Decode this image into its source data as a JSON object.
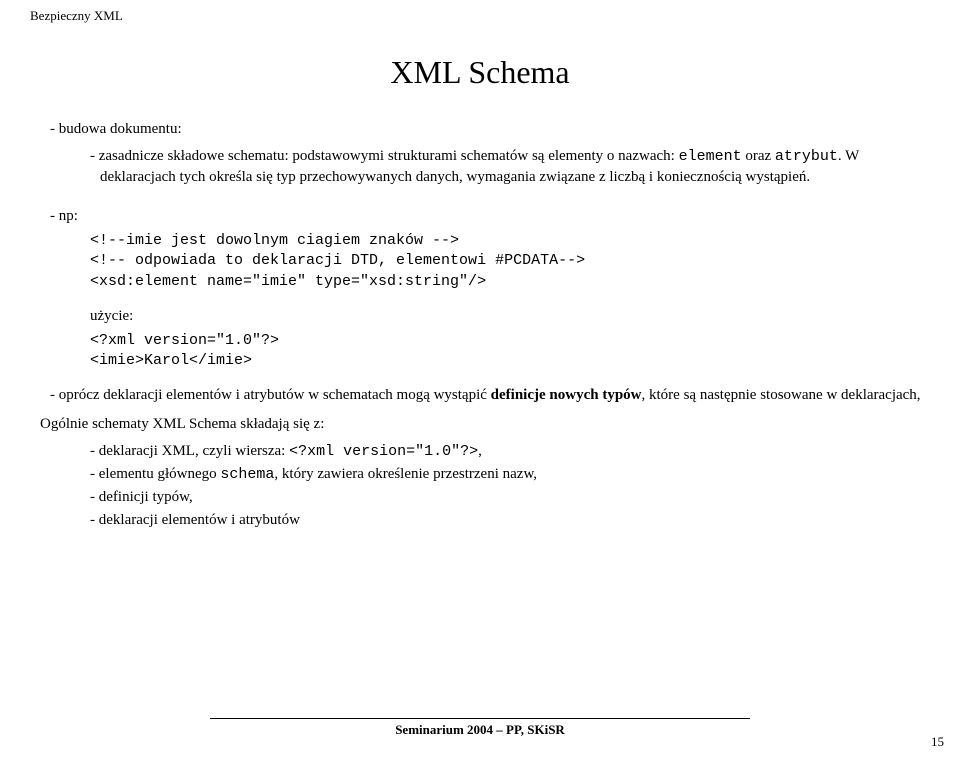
{
  "header": "Bezpieczny XML",
  "title": "XML Schema",
  "section1": "- budowa dokumentu:",
  "bullet1a": "- zasadnicze składowe schematu: podstawowymi strukturami schematów są elementy o nazwach: ",
  "bullet1b_code1": "element",
  "bullet1b_mid": " oraz ",
  "bullet1b_code2": "atrybut",
  "bullet1c": ". W deklaracjach tych określa się typ przechowywanych danych, wymagania związane z liczbą i koniecznością wystąpień.",
  "np_label": "- np:",
  "code1": "<!--imie jest dowolnym ciagiem znaków -->\n<!-- odpowiada to deklaracji DTD, elementowi #PCDATA-->\n<xsd:element name=\"imie\" type=\"xsd:string\"/>",
  "usage_label": "użycie:",
  "code2": "<?xml version=\"1.0\"?>\n<imie>Karol</imie>",
  "para3a": "- oprócz deklaracji elementów i atrybutów w schematach mogą wystąpić ",
  "para3b_bold": "definicje nowych typów",
  "para3c": ", które są następnie stosowane w deklaracjach,",
  "para4": "Ogólnie schematy XML Schema składają się z:",
  "li1a": "- deklaracji XML, czyli wiersza: ",
  "li1b_code": "<?xml version=\"1.0\"?>",
  "li1c": ",",
  "li2a": "- elementu głównego ",
  "li2b_code": "schema",
  "li2c": ", który zawiera określenie przestrzeni nazw,",
  "li3": "- definicji typów,",
  "li4": "- deklaracji elementów i atrybutów",
  "footer": "Seminarium 2004 – PP, SKiSR",
  "page_num": "15"
}
